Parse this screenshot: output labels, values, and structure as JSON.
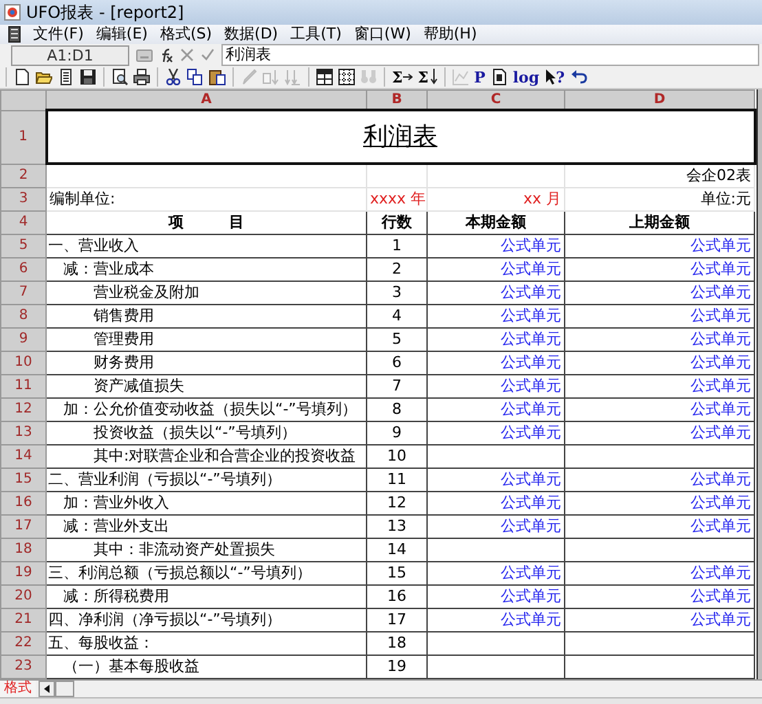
{
  "window": {
    "title": "UFO报表 - [report2]"
  },
  "menu": [
    "文件(F)",
    "编辑(E)",
    "格式(S)",
    "数据(D)",
    "工具(T)",
    "窗口(W)",
    "帮助(H)"
  ],
  "formula_bar": {
    "cell": "A1:D1",
    "value": "利润表"
  },
  "toolbar": [
    {
      "items": [
        {
          "disabled": false
        },
        {
          "disabled": false
        },
        {
          "disabled": false
        },
        {
          "disabled": false
        }
      ]
    },
    {
      "items": [
        {
          "disabled": false
        },
        {
          "disabled": false
        }
      ]
    },
    {
      "items": [
        {
          "disabled": false
        },
        {
          "disabled": false
        },
        {
          "disabled": false
        }
      ]
    },
    {
      "items": [
        {
          "disabled": true
        },
        {
          "disabled": true
        },
        {
          "disabled": true
        }
      ]
    },
    {
      "items": [
        {
          "disabled": false
        },
        {
          "disabled": false
        },
        {
          "disabled": true
        }
      ]
    },
    {
      "items": [
        {
          "disabled": false,
          "glyph": "Σ"
        },
        {
          "disabled": false,
          "glyph": "Σ"
        }
      ]
    },
    {
      "items": [
        {
          "disabled": true
        },
        {
          "disabled": false,
          "glyph": "P"
        },
        {
          "disabled": false
        },
        {
          "disabled": false,
          "glyph": "log"
        },
        {
          "disabled": false,
          "glyph": "?"
        },
        {
          "disabled": false
        }
      ]
    }
  ],
  "sheet": {
    "columns": [
      "A",
      "B",
      "C",
      "D"
    ],
    "title_row": "1",
    "title": "利润表",
    "form_row": "2",
    "form_no": "会企02表",
    "info_row": "3",
    "unit_label": "编制单位:",
    "year": "xxxx 年",
    "month": "xx 月",
    "unit": "单位:元",
    "header_row": "4",
    "headers": [
      "项　　　目",
      "行数",
      "本期金额",
      "上期金额"
    ],
    "items": [
      {
        "row": "5",
        "label": "一、营业收入",
        "line": "1",
        "current": "公式单元",
        "prior": "公式单元",
        "children": [
          {
            "row": "6",
            "label": "减：营业成本",
            "line": "2",
            "current": "公式单元",
            "prior": "公式单元",
            "children": [
              {
                "row": "7",
                "label": "营业税金及附加",
                "line": "3",
                "current": "公式单元",
                "prior": "公式单元"
              },
              {
                "row": "8",
                "label": "销售费用",
                "line": "4",
                "current": "公式单元",
                "prior": "公式单元"
              },
              {
                "row": "9",
                "label": "管理费用",
                "line": "5",
                "current": "公式单元",
                "prior": "公式单元"
              },
              {
                "row": "10",
                "label": "财务费用",
                "line": "6",
                "current": "公式单元",
                "prior": "公式单元"
              },
              {
                "row": "11",
                "label": "资产减值损失",
                "line": "7",
                "current": "公式单元",
                "prior": "公式单元"
              }
            ]
          },
          {
            "row": "12",
            "label": "加：公允价值变动收益（损失以“-”号填列）",
            "line": "8",
            "current": "公式单元",
            "prior": "公式单元",
            "children": [
              {
                "row": "13",
                "label": "投资收益（损失以“-”号填列）",
                "line": "9",
                "current": "公式单元",
                "prior": "公式单元"
              },
              {
                "row": "14",
                "label": "其中:对联营企业和合营企业的投资收益",
                "line": "10"
              }
            ]
          }
        ]
      },
      {
        "row": "15",
        "label": "二、营业利润（亏损以“-”号填列）",
        "line": "11",
        "current": "公式单元",
        "prior": "公式单元",
        "children": [
          {
            "row": "16",
            "label": "加：营业外收入",
            "line": "12",
            "current": "公式单元",
            "prior": "公式单元"
          },
          {
            "row": "17",
            "label": "减：营业外支出",
            "line": "13",
            "current": "公式单元",
            "prior": "公式单元",
            "children": [
              {
                "row": "18",
                "label": "其中：非流动资产处置损失",
                "line": "14"
              }
            ]
          }
        ]
      },
      {
        "row": "19",
        "label": "三、利润总额（亏损总额以“-”号填列）",
        "line": "15",
        "current": "公式单元",
        "prior": "公式单元",
        "children": [
          {
            "row": "20",
            "label": "减：所得税费用",
            "line": "16",
            "current": "公式单元",
            "prior": "公式单元"
          }
        ]
      },
      {
        "row": "21",
        "label": "四、净利润（净亏损以“-”号填列）",
        "line": "17",
        "current": "公式单元",
        "prior": "公式单元"
      },
      {
        "row": "22",
        "label": "五、每股收益：",
        "line": "18",
        "children": [
          {
            "row": "23",
            "label": "（一）基本每股收益",
            "line": "19"
          }
        ]
      }
    ]
  },
  "sheet_tabs": [
    {
      "label": "格式",
      "selected": true
    }
  ]
}
